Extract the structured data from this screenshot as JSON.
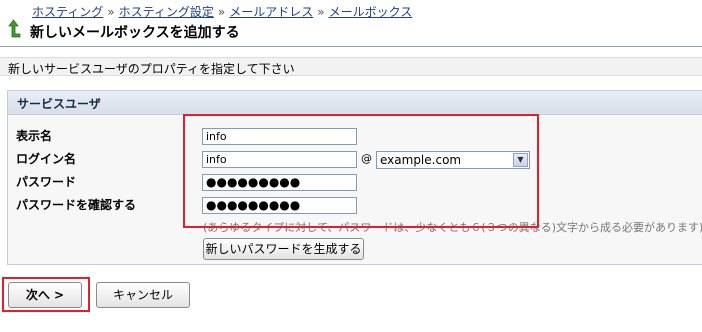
{
  "breadcrumb": {
    "items": [
      "ホスティング",
      "ホスティング設定",
      "メールアドレス",
      "メールボックス"
    ],
    "separator": "»"
  },
  "page": {
    "title": "新しいメールボックスを追加する",
    "hint": "新しいサービスユーザのプロパティを指定して下さい"
  },
  "section": {
    "title": "サービスユーザ"
  },
  "form": {
    "display_name_label": "表示名",
    "display_name_value": "info",
    "login_label": "ログイン名",
    "login_value": "info",
    "at_sign": "@",
    "domain_selected": "example.com",
    "password_label": "パスワード",
    "password_value": "●●●●●●●●●",
    "confirm_label": "パスワードを確認する",
    "confirm_value": "●●●●●●●●●",
    "password_hint": "(あらゆるタイプに対して、パスワードは、少なくとも６(３つの異なる)文字から成る必要があります)",
    "generate_button": "新しいパスワードを生成する"
  },
  "actions": {
    "next_label": "次へ >",
    "cancel_label": "キャンセル"
  },
  "colors": {
    "highlight": "#e0202b",
    "link": "#1f3f8f"
  },
  "icons": {
    "up": "up-arrow-icon",
    "dropdown": "chevron-down-icon"
  }
}
